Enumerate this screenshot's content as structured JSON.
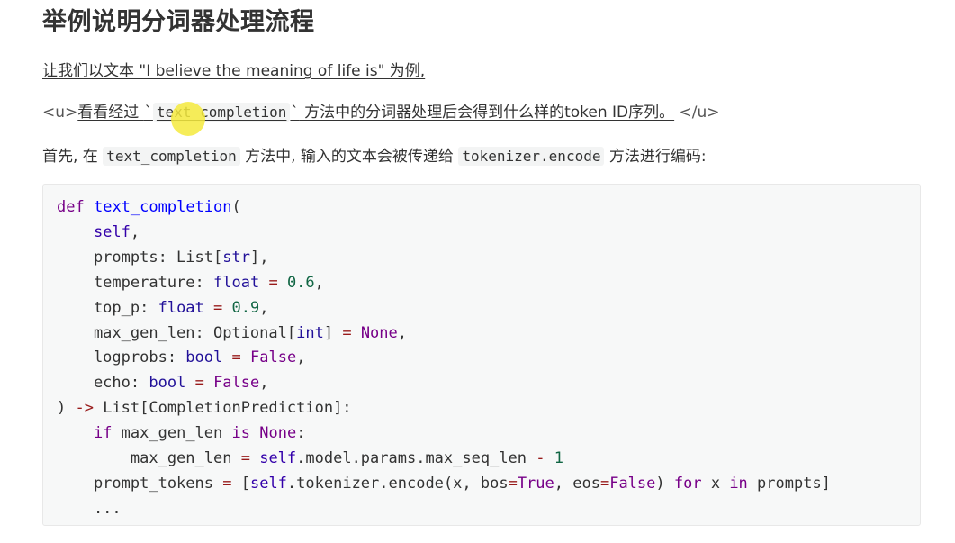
{
  "heading": "举例说明分词器处理流程",
  "para1": "让我们以文本 \"I believe the meaning of life is\" 为例,",
  "para2": {
    "tag_open": "<u>",
    "text_a": "看看经过 ",
    "tick": "`",
    "code": "text_completion",
    "text_b": " 方法中的分词器处理后会得到什么样的token ID序列。",
    "tag_close": "</u>"
  },
  "para3": {
    "text_a": "首先, 在 ",
    "code_a": "text_completion",
    "text_b": " 方法中, 输入的文本会被传递给 ",
    "code_b": "tokenizer.encode",
    "text_c": " 方法进行编码:"
  },
  "code_lines": [
    "def text_completion(",
    "    self,",
    "    prompts: List[str],",
    "    temperature: float = 0.6,",
    "    top_p: float = 0.9,",
    "    max_gen_len: Optional[int] = None,",
    "    logprobs: bool = False,",
    "    echo: bool = False,",
    ") -> List[CompletionPrediction]:",
    "    if max_gen_len is None:",
    "        max_gen_len = self.model.params.max_seq_len - 1",
    "    prompt_tokens = [self.tokenizer.encode(x, bos=True, eos=False) for x in prompts]",
    "    ..."
  ]
}
